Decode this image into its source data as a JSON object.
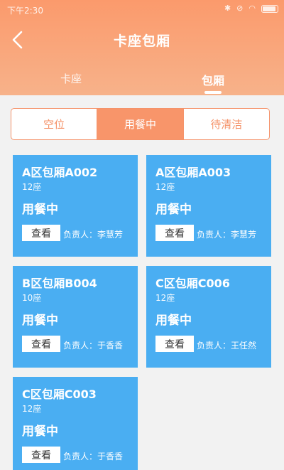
{
  "status_bar": {
    "time": "下午2:30"
  },
  "header": {
    "title": "卡座包厢",
    "tabs": [
      {
        "label": "卡座"
      },
      {
        "label": "包厢"
      }
    ]
  },
  "segments": [
    {
      "label": "空位"
    },
    {
      "label": "用餐中"
    },
    {
      "label": "待清洁"
    }
  ],
  "colors": {
    "accent": "#f8956a",
    "card": "#4aaef2"
  },
  "rooms": [
    {
      "name": "A区包厢A002",
      "seats": "12座",
      "status": "用餐中",
      "button": "查看",
      "manager": "负责人：李慧芳"
    },
    {
      "name": "A区包厢A003",
      "seats": "12座",
      "status": "用餐中",
      "button": "查看",
      "manager": "负责人：李慧芳"
    },
    {
      "name": "B区包厢B004",
      "seats": "10座",
      "status": "用餐中",
      "button": "查看",
      "manager": "负责人：于香香"
    },
    {
      "name": "C区包厢C006",
      "seats": "12座",
      "status": "用餐中",
      "button": "查看",
      "manager": "负责人：王任然"
    },
    {
      "name": "C区包厢C003",
      "seats": "12座",
      "status": "用餐中",
      "button": "查看",
      "manager": "负责人：于香香"
    }
  ]
}
